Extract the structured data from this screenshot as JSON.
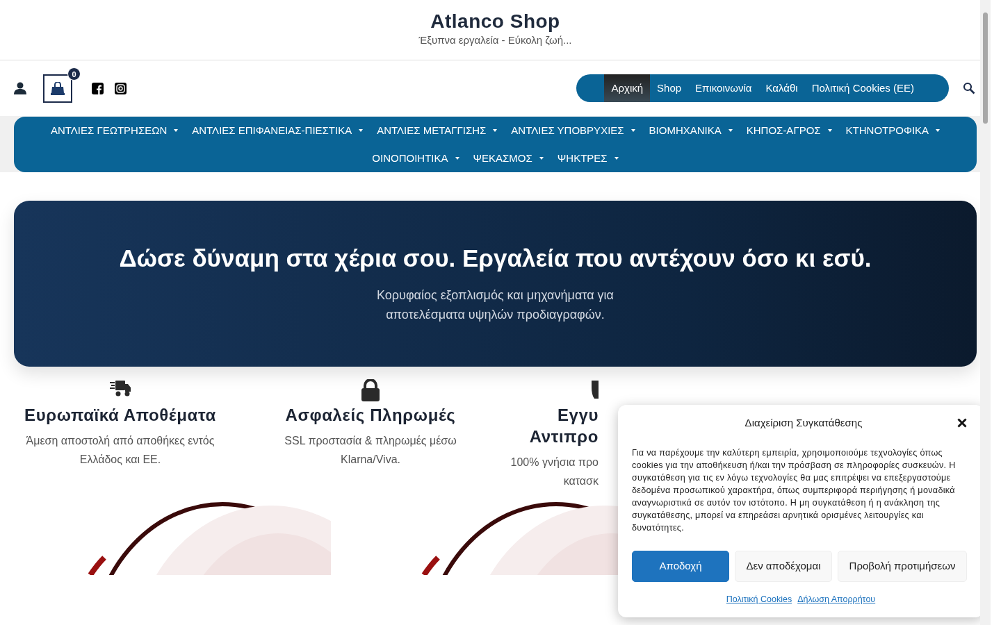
{
  "site": {
    "title": "Atlanco Shop",
    "tagline": "Έξυπνα εργαλεία - Εύκολη ζωή..."
  },
  "cart": {
    "count": "0"
  },
  "main_menu": [
    {
      "label": "Αρχική",
      "selected": true
    },
    {
      "label": "Shop",
      "selected": false
    },
    {
      "label": "Επικοινωνία",
      "selected": false
    },
    {
      "label": "Καλάθι",
      "selected": false
    },
    {
      "label": "Πολιτική Cookies (EE)",
      "selected": false
    }
  ],
  "categories": [
    {
      "label": "ΑΝΤΛΙΕΣ ΓΕΩΤΡΗΣΕΩΝ"
    },
    {
      "label": "ΑΝΤΛΙΕΣ ΕΠΙΦΑΝΕΙΑΣ-ΠΙΕΣΤΙΚΑ"
    },
    {
      "label": "ΑΝΤΛΙΕΣ ΜΕΤΑΓΓΙΣΗΣ"
    },
    {
      "label": "ΑΝΤΛΙΕΣ ΥΠΟΒΡΥΧΙΕΣ"
    },
    {
      "label": "ΒΙΟΜΗΧΑΝΙΚΑ"
    },
    {
      "label": "ΚΗΠΟΣ-ΑΓΡΟΣ"
    },
    {
      "label": "ΚΤΗΝΟΤΡΟΦΙΚΑ"
    },
    {
      "label": "ΟΙΝΟΠΟΙΗΤΙΚΑ"
    },
    {
      "label": "ΨΕΚΑΣΜΟΣ"
    },
    {
      "label": "ΨΗΚΤΡΕΣ"
    }
  ],
  "hero": {
    "title": "Δώσε δύναμη στα χέρια σου. Εργαλεία που αντέχουν όσο κι εσύ.",
    "subtitle": "Κορυφαίος εξοπλισμός και μηχανήματα για αποτελέσματα υψηλών προδιαγραφών."
  },
  "features": [
    {
      "kind": "truck",
      "title_lines": [
        "Ευρωπαϊκά Αποθέματα"
      ],
      "description_lines": [
        "Άμεση αποστολή από αποθήκες εντός",
        "Ελλάδος και ΕΕ."
      ]
    },
    {
      "kind": "lock",
      "title_lines": [
        "Ασφαλείς Πληρωμές"
      ],
      "description_lines": [
        "SSL προστασία & πληρωμές μέσω",
        "Klarna/Viva."
      ]
    },
    {
      "kind": "partial",
      "title_lines": [
        "Εγγυ",
        "Αντιπρο"
      ],
      "description_lines": [
        "100% γνήσια προ",
        "κατασκ"
      ]
    }
  ],
  "consent": {
    "title": "Διαχείριση Συγκατάθεσης",
    "body": "Για να παρέχουμε την καλύτερη εμπειρία, χρησιμοποιούμε τεχνολογίες όπως cookies για την αποθήκευση ή/και την πρόσβαση σε πληροφορίες συσκευών. Η συγκατάθεση για τις εν λόγω τεχνολογίες θα μας επιτρέψει να επεξεργαστούμε δεδομένα προσωπικού χαρακτήρα, όπως συμπεριφορά περιήγησης ή μοναδικά αναγνωριστικά σε αυτόν τον ιστότοπο. Η μη συγκατάθεση ή η ανάκληση της συγκατάθεσης, μπορεί να επηρεάσει αρνητικά ορισμένες λειτουργίες και δυνατότητες.",
    "buttons": [
      {
        "label": "Αποδοχή",
        "kind": "primary"
      },
      {
        "label": "Δεν αποδέχομαι",
        "kind": "secondary"
      },
      {
        "label": "Προβολή προτιμήσεων",
        "kind": "secondary"
      }
    ],
    "links": [
      "Πολιτική Cookies",
      "Δήλωση Απορρήτου"
    ]
  }
}
